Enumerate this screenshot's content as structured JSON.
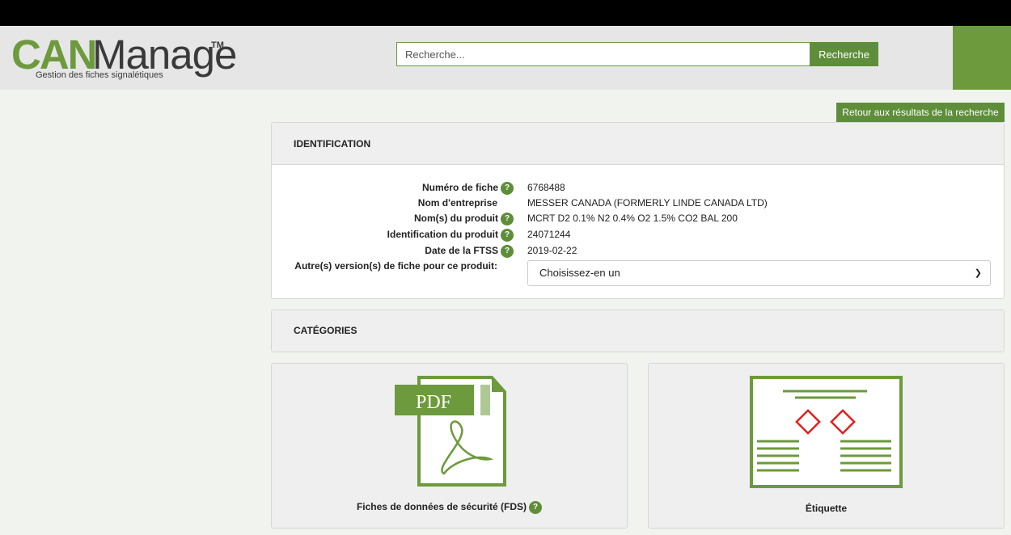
{
  "header": {
    "logo": {
      "can": "CAN",
      "manage": "Manage",
      "tm": "TM",
      "subtitle": "Gestion des fiches signalétiques"
    },
    "search": {
      "placeholder": "Recherche...",
      "button_label": "Recherche"
    }
  },
  "back_button_label": "Retour aux résultats de la recherche",
  "identification": {
    "title": "IDENTIFICATION",
    "rows": [
      {
        "label": "Numéro de fiche",
        "value": "6768488",
        "help": true
      },
      {
        "label": "Nom d'entreprise",
        "value": "MESSER CANADA (FORMERLY LINDE CANADA LTD)",
        "help": false
      },
      {
        "label": "Nom(s) du produit",
        "value": "MCRT D2 0.1% N2 0.4% O2 1.5% CO2 BAL 200",
        "help": true
      },
      {
        "label": "Identification du produit",
        "value": "24071244",
        "help": true
      },
      {
        "label": "Date de la FTSS",
        "value": "2019-02-22",
        "help": true
      }
    ],
    "versions_label": "Autre(s) version(s) de fiche pour ce produit:",
    "versions_select": "Choisissez-en un"
  },
  "categories": {
    "title": "CATÉGORIES",
    "cards": [
      {
        "label": "Fiches de données de sécurité (FDS)",
        "icon": "pdf-icon",
        "icon_text": "PDF",
        "help": true
      },
      {
        "label": "Étiquette",
        "icon": "label-icon",
        "help": false
      }
    ]
  },
  "help_glyph": "?",
  "colors": {
    "accent": "#6c9a3c",
    "button": "#5e8e3a",
    "hazard": "#e02020"
  }
}
